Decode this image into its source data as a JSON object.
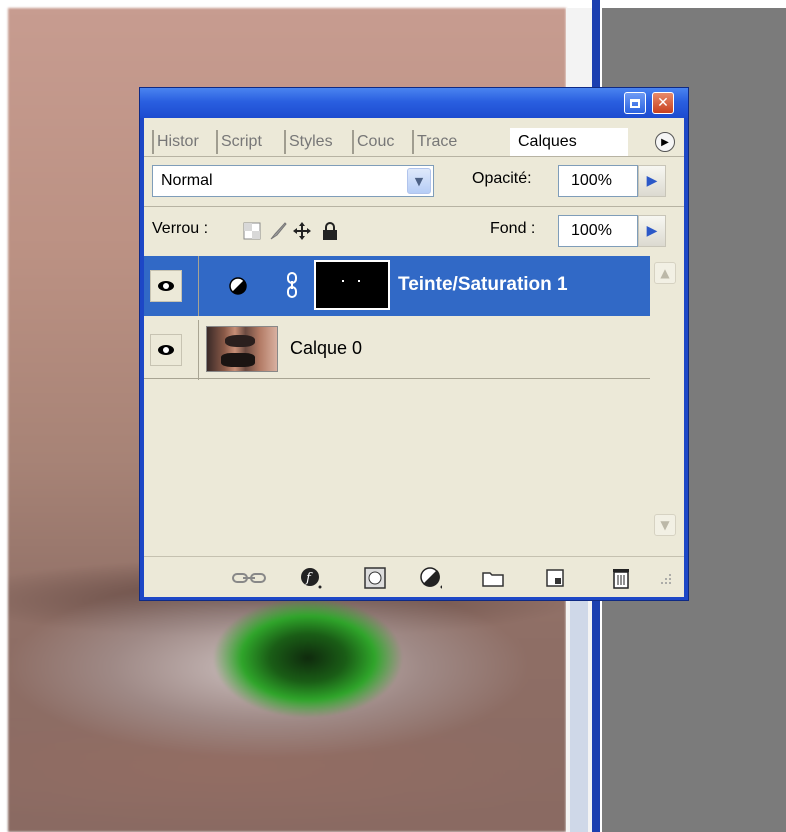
{
  "window": {
    "minimize_icon": "minimize-icon",
    "close_icon": "close-icon",
    "close_glyph": "✕"
  },
  "tabs": [
    {
      "label": "Histor"
    },
    {
      "label": "Script"
    },
    {
      "label": "Styles"
    },
    {
      "label": "Couc"
    },
    {
      "label": "Trace"
    },
    {
      "label": "Calques",
      "active": true
    }
  ],
  "tab_menu_glyph": "▶",
  "blend": {
    "mode": "Normal",
    "opacity_label": "Opacité:",
    "opacity_value": "100%",
    "arrow_glyph": "▶"
  },
  "lock": {
    "label": "Verrou :",
    "fill_label": "Fond :",
    "fill_value": "100%"
  },
  "layers": [
    {
      "name": "Teinte/Saturation 1",
      "selected": true,
      "visible": true,
      "type": "adjustment"
    },
    {
      "name": "Calque 0",
      "selected": false,
      "visible": true,
      "type": "image"
    }
  ],
  "scroll": {
    "up_glyph": "▲",
    "down_glyph": "▼"
  },
  "colors": {
    "selection": "#3169c6",
    "panel_bg": "#ece9d8",
    "title_blue": "#2a5fe0"
  }
}
